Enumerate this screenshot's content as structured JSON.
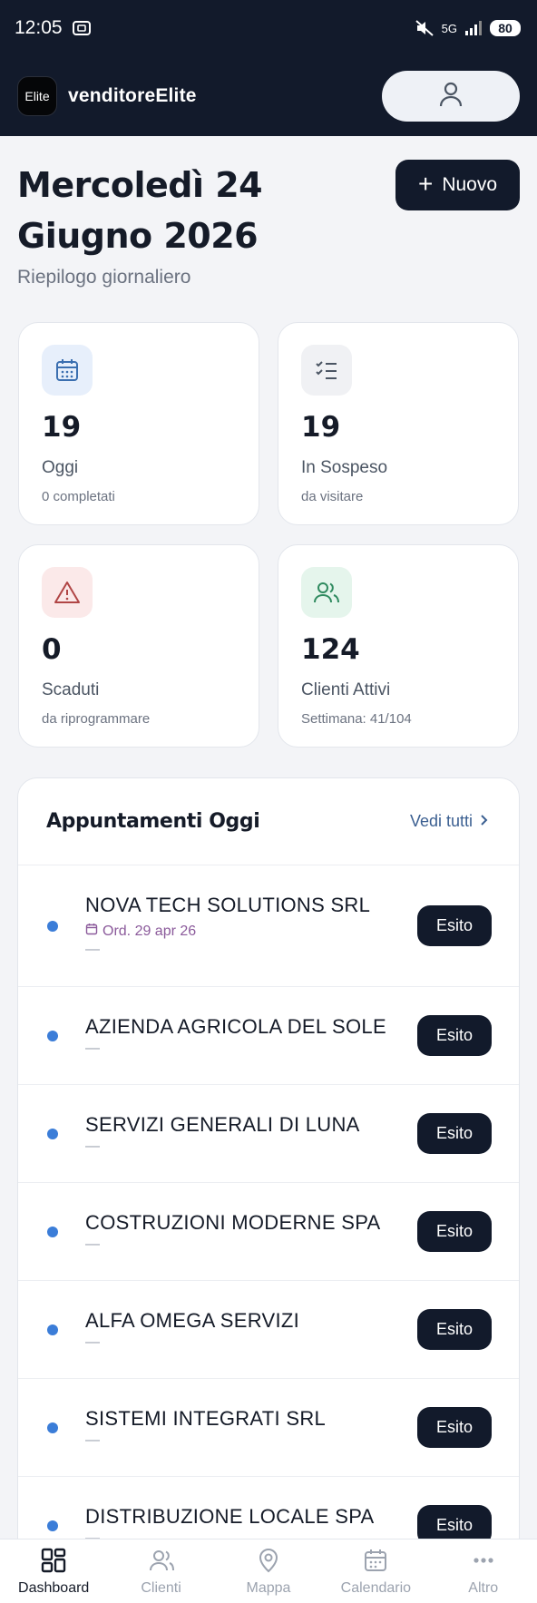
{
  "status_bar": {
    "time": "12:05",
    "network": "5G",
    "battery": "80"
  },
  "header": {
    "logo_text": "Elite",
    "app_name": "venditoreElite"
  },
  "page": {
    "title": "Mercoledì 24 Giugno 2026",
    "subtitle": "Riepilogo giornaliero",
    "new_button": "Nuovo"
  },
  "stats": [
    {
      "value": "19",
      "label": "Oggi",
      "sub": "0 completati",
      "icon": "calendar-icon",
      "color": "#3b6fb0",
      "bg": "#e7effb"
    },
    {
      "value": "19",
      "label": "In Sospeso",
      "sub": "da visitare",
      "icon": "checklist-icon",
      "color": "#4b5563",
      "bg": "#f0f1f4"
    },
    {
      "value": "0",
      "label": "Scaduti",
      "sub": "da riprogrammare",
      "icon": "warning-icon",
      "color": "#b04545",
      "bg": "#fbe9e9"
    },
    {
      "value": "124",
      "label": "Clienti Attivi",
      "sub": "Settimana: 41/104",
      "icon": "users-icon",
      "color": "#2f8a5f",
      "bg": "#e5f5ec"
    }
  ],
  "appointments": {
    "title": "Appuntamenti Oggi",
    "see_all": "Vedi tutti",
    "action_label": "Esito",
    "items": [
      {
        "name": "NOVA TECH SOLUTIONS SRL",
        "order": "Ord. 29 apr 26",
        "detail": "—"
      },
      {
        "name": "AZIENDA AGRICOLA DEL SOLE",
        "detail": "—"
      },
      {
        "name": "SERVIZI GENERALI DI LUNA",
        "detail": "—"
      },
      {
        "name": "COSTRUZIONI MODERNE SPA",
        "detail": "—"
      },
      {
        "name": "ALFA OMEGA SERVIZI",
        "detail": "—"
      },
      {
        "name": "SISTEMI INTEGRATI SRL",
        "detail": "—"
      },
      {
        "name": "DISTRIBUZIONE LOCALE SPA",
        "detail": "—"
      }
    ]
  },
  "bottom_nav": [
    {
      "label": "Dashboard",
      "icon": "grid-icon",
      "active": true
    },
    {
      "label": "Clienti",
      "icon": "users-icon",
      "active": false
    },
    {
      "label": "Mappa",
      "icon": "map-pin-icon",
      "active": false
    },
    {
      "label": "Calendario",
      "icon": "calendar-icon",
      "active": false
    },
    {
      "label": "Altro",
      "icon": "more-icon",
      "active": false
    }
  ],
  "colors": {
    "header_bg": "#121a2b",
    "accent_dot": "#3b7dd8",
    "link": "#3b5f91"
  }
}
